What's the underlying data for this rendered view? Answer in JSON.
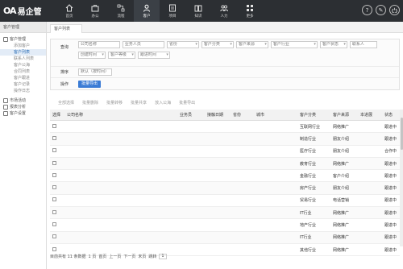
{
  "app": {
    "logo_mark": "OA",
    "logo_text": "易企管"
  },
  "nav": [
    {
      "label": "首页",
      "icon": "home-icon"
    },
    {
      "label": "办公",
      "icon": "briefcase-icon"
    },
    {
      "label": "流程",
      "icon": "flow-icon"
    },
    {
      "label": "客户",
      "icon": "customer-icon"
    },
    {
      "label": "项目",
      "icon": "project-icon"
    },
    {
      "label": "知识",
      "icon": "book-icon"
    },
    {
      "label": "人力",
      "icon": "people-icon"
    },
    {
      "label": "更多",
      "icon": "grid-icon"
    }
  ],
  "topbar": {
    "help_icon": "?",
    "edit_icon": "✎"
  },
  "sidebar": {
    "head": "客户管理",
    "group1": "客户管理",
    "items": [
      "添加客户",
      "客户列表",
      "联系人列表",
      "客户公海",
      "合同列表",
      "客户跟进",
      "客户记录",
      "操作日志"
    ],
    "group2": "市场活动",
    "group3": "报表分析",
    "group4": "客户设置"
  },
  "tabs": {
    "current": "客户列表"
  },
  "filters": {
    "search_label": "查询",
    "company_placeholder": "公司名称",
    "owner_placeholder": "业务人员",
    "province_placeholder": "省份",
    "category_placeholder": "客户分类",
    "source_placeholder": "客户来源",
    "industry_placeholder": "客户行业",
    "stage_placeholder": "客户状态",
    "contact_placeholder": "联系人",
    "created_placeholder": "创建时间",
    "level_placeholder": "客户等级",
    "followup_placeholder": "跟进时间",
    "order_label": "排序",
    "order_value": "默认（按时间）",
    "action_label": "操作",
    "action_button": "批量导出"
  },
  "toolbar": [
    "全部选择",
    "批量删除",
    "批量转移",
    "批量共享",
    "放入公海",
    "批量导出"
  ],
  "table": {
    "headers": [
      "选择",
      "公司名称",
      "业务员",
      "接触日期",
      "省份",
      "城市",
      "客户分类",
      "客户来源",
      "本进展",
      "状态"
    ],
    "rows": [
      {
        "company": "",
        "owner": "",
        "date": "",
        "province": "",
        "city": "",
        "category": "互联网行业",
        "source": "网络推广",
        "progress": "",
        "status": "跟进中"
      },
      {
        "company": "",
        "owner": "",
        "date": "",
        "province": "",
        "city": "",
        "category": "制造行业",
        "source": "朋友介绍",
        "progress": "",
        "status": "跟进中"
      },
      {
        "company": "",
        "owner": "",
        "date": "",
        "province": "",
        "city": "",
        "category": "医疗行业",
        "source": "朋友介绍",
        "progress": "",
        "status": "合作中"
      },
      {
        "company": "",
        "owner": "",
        "date": "",
        "province": "",
        "city": "",
        "category": "教育行业",
        "source": "网络推广",
        "progress": "",
        "status": "跟进中"
      },
      {
        "company": "",
        "owner": "",
        "date": "",
        "province": "",
        "city": "",
        "category": "金融行业",
        "source": "客户介绍",
        "progress": "",
        "status": "跟进中"
      },
      {
        "company": "",
        "owner": "",
        "date": "",
        "province": "",
        "city": "",
        "category": "房产行业",
        "source": "朋友介绍",
        "progress": "",
        "status": "跟进中"
      },
      {
        "company": "",
        "owner": "",
        "date": "",
        "province": "",
        "city": "",
        "category": "贸易行业",
        "source": "电话营销",
        "progress": "",
        "status": "跟进中"
      },
      {
        "company": "",
        "owner": "",
        "date": "",
        "province": "",
        "city": "",
        "category": "IT行业",
        "source": "网络推广",
        "progress": "",
        "status": "跟进中"
      },
      {
        "company": "",
        "owner": "",
        "date": "",
        "province": "",
        "city": "",
        "category": "地产行业",
        "source": "网络推广",
        "progress": "",
        "status": "跟进中"
      },
      {
        "company": "",
        "owner": "",
        "date": "",
        "province": "",
        "city": "",
        "category": "IT行业",
        "source": "网络推广",
        "progress": "",
        "status": "跟进中"
      },
      {
        "company": "",
        "owner": "",
        "date": "",
        "province": "",
        "city": "",
        "category": "其他行业",
        "source": "网络推广",
        "progress": "",
        "status": "跟进中"
      }
    ]
  },
  "footer": {
    "summary": "目前共有 11 条数据",
    "page_label": "1 页",
    "first": "首页",
    "prev": "上一页",
    "next": "下一页",
    "last": "末页",
    "jump": "跳转",
    "page_value": "1"
  }
}
